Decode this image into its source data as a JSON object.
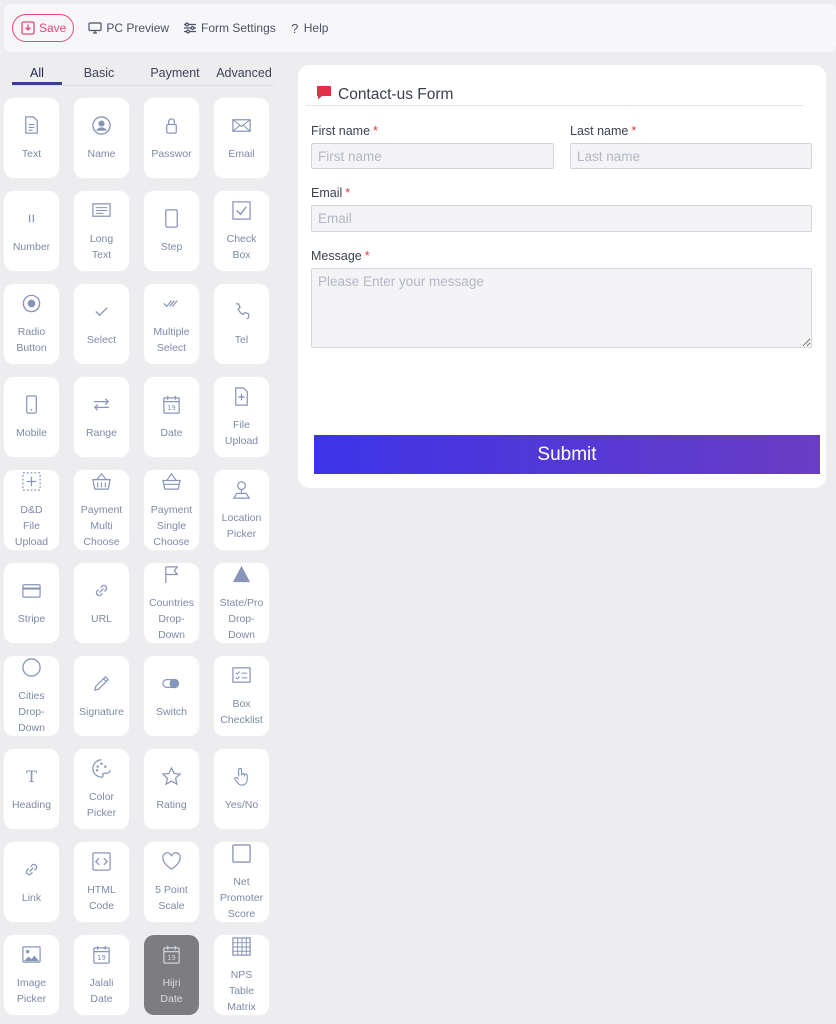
{
  "toolbar": {
    "save_label": "Save",
    "preview_label": "PC Preview",
    "settings_label": "Form Settings",
    "help_label": "Help"
  },
  "colors": {
    "accent_pink": "#e8457a",
    "submit_gradient_start": "#3d34e8",
    "submit_gradient_end": "#6a3dc4",
    "icon": "#8795b8"
  },
  "tabs": [
    "All",
    "Basic",
    "Payment",
    "Advanced"
  ],
  "active_tab": "All",
  "palette": [
    {
      "label": "Text",
      "icon": "document-icon"
    },
    {
      "label": "Name",
      "icon": "user-circle-icon"
    },
    {
      "label": "Passwor",
      "icon": "lock-icon"
    },
    {
      "label": "Email",
      "icon": "envelope-icon"
    },
    {
      "label": "Number",
      "icon": "number-bars-icon"
    },
    {
      "label": "Long\nText",
      "icon": "long-text-icon"
    },
    {
      "label": "Step",
      "icon": "step-icon"
    },
    {
      "label": "Check\nBox",
      "icon": "checkbox-icon"
    },
    {
      "label": "Radio\nButton",
      "icon": "radio-icon"
    },
    {
      "label": "Select",
      "icon": "check-icon"
    },
    {
      "label": "Multiple\nSelect",
      "icon": "double-check-icon"
    },
    {
      "label": "Tel",
      "icon": "phone-icon"
    },
    {
      "label": "Mobile",
      "icon": "mobile-icon"
    },
    {
      "label": "Range",
      "icon": "range-arrows-icon"
    },
    {
      "label": "Date",
      "icon": "calendar-icon"
    },
    {
      "label": "File\nUpload",
      "icon": "file-upload-icon"
    },
    {
      "label": "D&D\nFile\nUpload",
      "icon": "dashed-plus-icon"
    },
    {
      "label": "Payment\nMulti\nChoose",
      "icon": "basket-icon"
    },
    {
      "label": "Payment\nSingle\nChoose",
      "icon": "basket-outline-icon"
    },
    {
      "label": "Location\nPicker",
      "icon": "location-pin-icon"
    },
    {
      "label": "Stripe",
      "icon": "credit-card-icon"
    },
    {
      "label": "URL",
      "icon": "link-icon"
    },
    {
      "label": "Countries\nDrop-\nDown",
      "icon": "flag-icon"
    },
    {
      "label": "State/Pro\nDrop-\nDown",
      "icon": "triangle-icon"
    },
    {
      "label": "Cities\nDrop-\nDown",
      "icon": "circle-icon"
    },
    {
      "label": "Signature",
      "icon": "pencil-icon"
    },
    {
      "label": "Switch",
      "icon": "toggle-icon"
    },
    {
      "label": "Box\nChecklist",
      "icon": "checklist-icon"
    },
    {
      "label": "Heading",
      "icon": "heading-t-icon"
    },
    {
      "label": "Color\nPicker",
      "icon": "palette-icon"
    },
    {
      "label": "Rating",
      "icon": "star-icon"
    },
    {
      "label": "Yes/No",
      "icon": "hand-pointer-icon"
    },
    {
      "label": "Link",
      "icon": "link-icon"
    },
    {
      "label": "HTML\nCode",
      "icon": "code-icon"
    },
    {
      "label": "5 Point\nScale",
      "icon": "heart-icon"
    },
    {
      "label": "Net\nPromoter\nScore",
      "icon": "square-icon"
    },
    {
      "label": "Image\nPicker",
      "icon": "image-icon"
    },
    {
      "label": "Jalali\nDate",
      "icon": "calendar-icon"
    },
    {
      "label": "Hijri\nDate",
      "icon": "calendar-icon",
      "active": true
    },
    {
      "label": "NPS\nTable\nMatrix",
      "icon": "table-grid-icon"
    }
  ],
  "form": {
    "title": "Contact-us Form",
    "required_mark": "*",
    "first_name": {
      "label": "First name",
      "placeholder": "First name",
      "value": ""
    },
    "last_name": {
      "label": "Last name",
      "placeholder": "Last name",
      "value": ""
    },
    "email": {
      "label": "Email",
      "placeholder": "Email",
      "value": ""
    },
    "message": {
      "label": "Message",
      "placeholder": "Please Enter your message",
      "value": ""
    },
    "submit_label": "Submit"
  }
}
